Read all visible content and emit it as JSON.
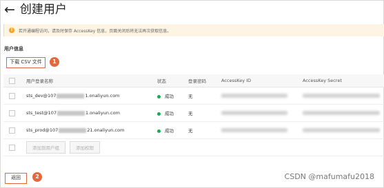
{
  "header": {
    "back_icon": "←",
    "title": "创建用户"
  },
  "alert": {
    "icon": "!",
    "text": "若开通编程访问，请及时保存 AccessKey 信息，页面关闭后将无法再次获取信息。"
  },
  "section": {
    "label": "用户信息"
  },
  "download_button": {
    "label": "下载 CSV 文件"
  },
  "markers": {
    "first": "1",
    "second": "2"
  },
  "table": {
    "columns": [
      "用户登录名称",
      "状态",
      "登录密码",
      "AccessKey ID",
      "AccessKey Secret"
    ],
    "rows": [
      {
        "name_prefix": "sts_dev@107",
        "name_suffix": "1.onaliyun.com",
        "status": "成功",
        "password": "无"
      },
      {
        "name_prefix": "sts_test@107",
        "name_suffix": "1.onaliyun.com",
        "status": "成功",
        "password": "无"
      },
      {
        "name_prefix": "sts_prod@107",
        "name_suffix": "21.onaliyun.com",
        "status": "成功",
        "password": "无"
      }
    ],
    "footer": {
      "add_to_group": "添加到用户组",
      "add_permission": "添加权限"
    }
  },
  "back_button": {
    "label": "返回"
  },
  "watermark": {
    "text": "CSDN @mafumafu2018"
  },
  "colors": {
    "accent": "#e2693d",
    "success": "#1aaa55",
    "warning": "#f5a623"
  }
}
